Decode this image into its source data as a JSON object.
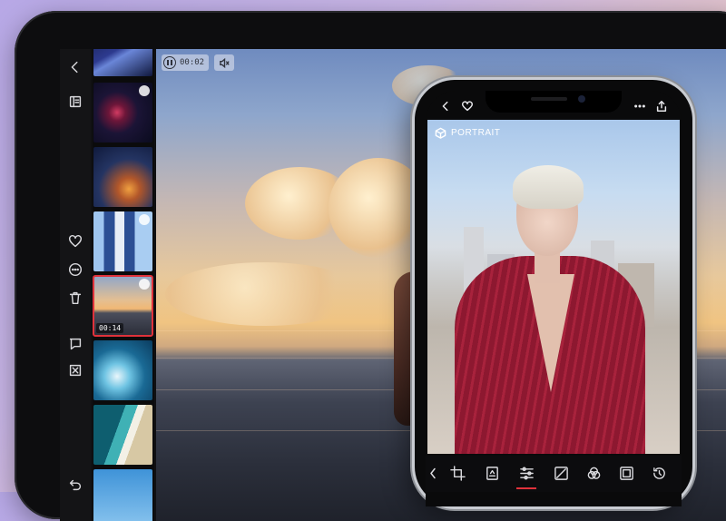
{
  "tablet": {
    "toolbar": {
      "icons": [
        "back-icon",
        "info-panel-icon",
        "heart-icon",
        "more-icon",
        "trash-icon",
        "comment-icon",
        "reject-icon",
        "undo-icon"
      ]
    },
    "thumbnails": [
      {
        "name": "thumb-blue-light",
        "selected": false,
        "editable": false
      },
      {
        "name": "thumb-jellyfish",
        "selected": false,
        "editable": true
      },
      {
        "name": "thumb-city-night",
        "selected": false,
        "editable": false
      },
      {
        "name": "thumb-skyscraper",
        "selected": false,
        "editable": true
      },
      {
        "name": "thumb-sunset-swim",
        "selected": true,
        "editable": true,
        "duration": "00:14"
      },
      {
        "name": "thumb-wave",
        "selected": false,
        "editable": false
      },
      {
        "name": "thumb-beach-aerial",
        "selected": false,
        "editable": false
      },
      {
        "name": "thumb-sky",
        "selected": false,
        "editable": false
      }
    ],
    "video": {
      "time": "00:02",
      "muted": true
    }
  },
  "phone": {
    "badge_label": "PORTRAIT",
    "tools": [
      "crop-icon",
      "adjust-image-icon",
      "sliders-icon",
      "curves-icon",
      "color-mix-icon",
      "frame-icon",
      "history-icon"
    ],
    "active_tool": "sliders-icon"
  },
  "colors": {
    "accent": "#e0323b",
    "toolbar": "#141416"
  }
}
